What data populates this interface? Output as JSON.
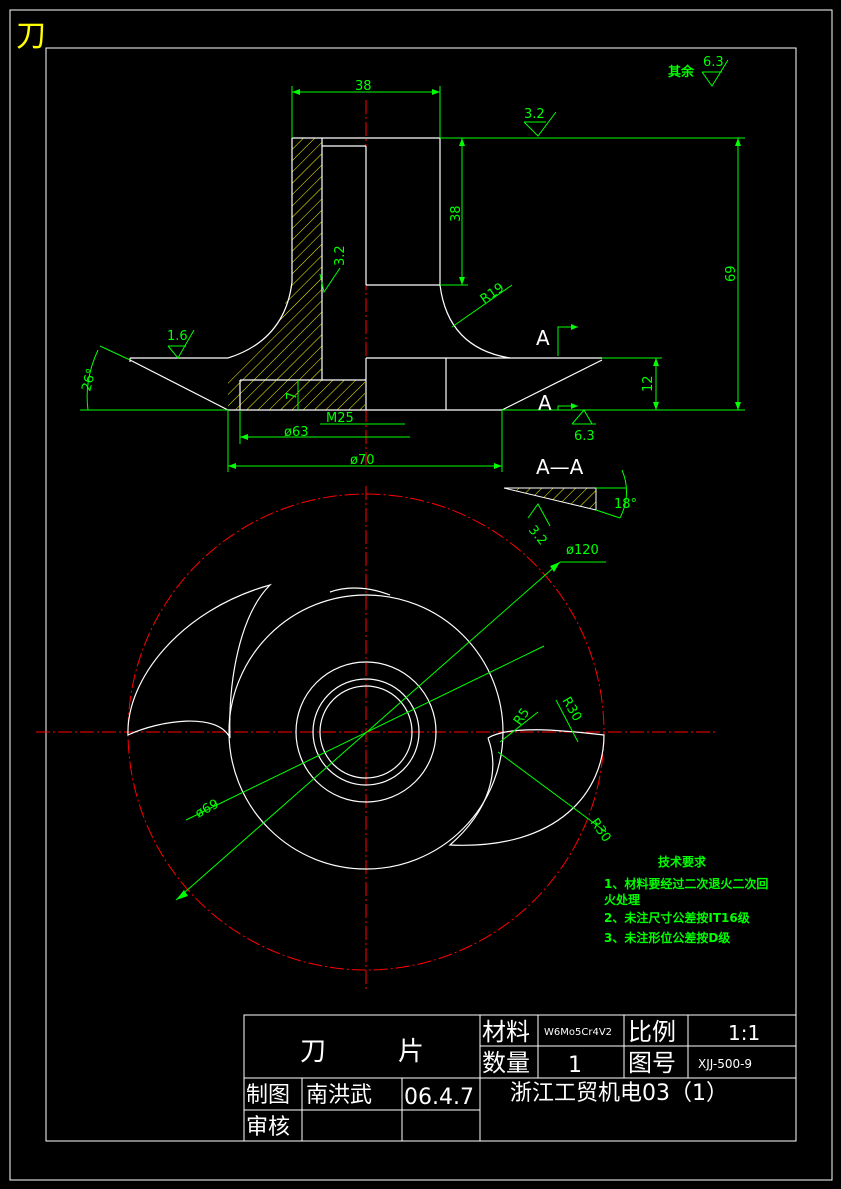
{
  "corner_label": "刀",
  "roughness": {
    "other": "其余",
    "other_value": "6.3",
    "top": "3.2",
    "flange": "1.6",
    "bore": "3.2",
    "bottom": "6.3",
    "section": "3.2"
  },
  "dimensions": {
    "width_top": "38",
    "height_bore": "38",
    "height_total": "69",
    "fillet": "R19",
    "angle": "26°",
    "flange_h": "12",
    "depth": "7",
    "thread": "M25",
    "d63": "ø63",
    "d70": "ø70",
    "d120": "ø120",
    "d69": "ø69",
    "r5": "R5",
    "r30a": "R30",
    "r30b": "R30",
    "section_angle": "18°"
  },
  "section": {
    "arrow_a": "A",
    "arrow_b": "A",
    "title": "A—A"
  },
  "notes": {
    "title": "技术要求",
    "line1a": "1、材料要经过二次退火二次回",
    "line1b": "火处理",
    "line2": "2、未注尺寸公差按IT16级",
    "line3": "3、未注形位公差按D级"
  },
  "title_block": {
    "part_name_1": "刀",
    "part_name_2": "片",
    "material_label": "材料",
    "material_value": "W6Mo5Cr4V2",
    "scale_label": "比例",
    "scale_value": "1:1",
    "qty_label": "数量",
    "qty_value": "1",
    "drawing_no_label": "图号",
    "drawing_no_value": "XJJ-500-9",
    "drawn_label": "制图",
    "drawn_name": "南洪武",
    "drawn_date": "06.4.7",
    "company": "浙江工贸机电03（1）",
    "checked_label": "审核"
  }
}
